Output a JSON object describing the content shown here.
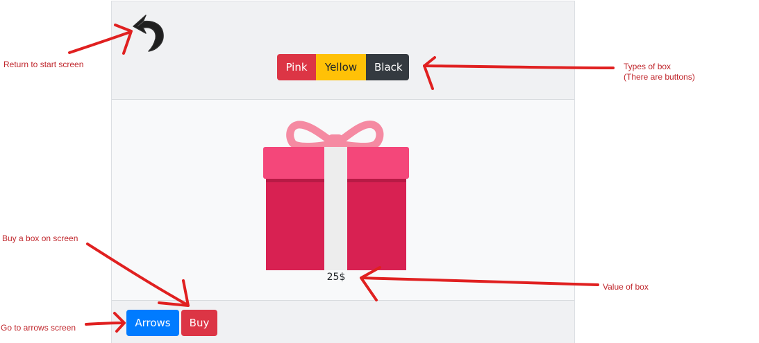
{
  "type_buttons": {
    "pink": "Pink",
    "yellow": "Yellow",
    "black": "Black"
  },
  "gift": {
    "price": "25$"
  },
  "footer": {
    "arrows_label": "Arrows",
    "buy_label": "Buy"
  },
  "annotations": {
    "return": "Return to start screen",
    "types_line1": "Types of box",
    "types_line2": "(There are buttons)",
    "buy": "Buy a box on screen",
    "value": "Value of box",
    "arrows": "Go to arrows screen"
  },
  "colors": {
    "pink": "#dc3545",
    "yellow": "#ffc107",
    "black": "#343a40",
    "arrows": "#007bff",
    "annotation": "#e02020"
  },
  "icons": {
    "back": "back-arrow-icon",
    "gift": "gift-box-icon"
  }
}
